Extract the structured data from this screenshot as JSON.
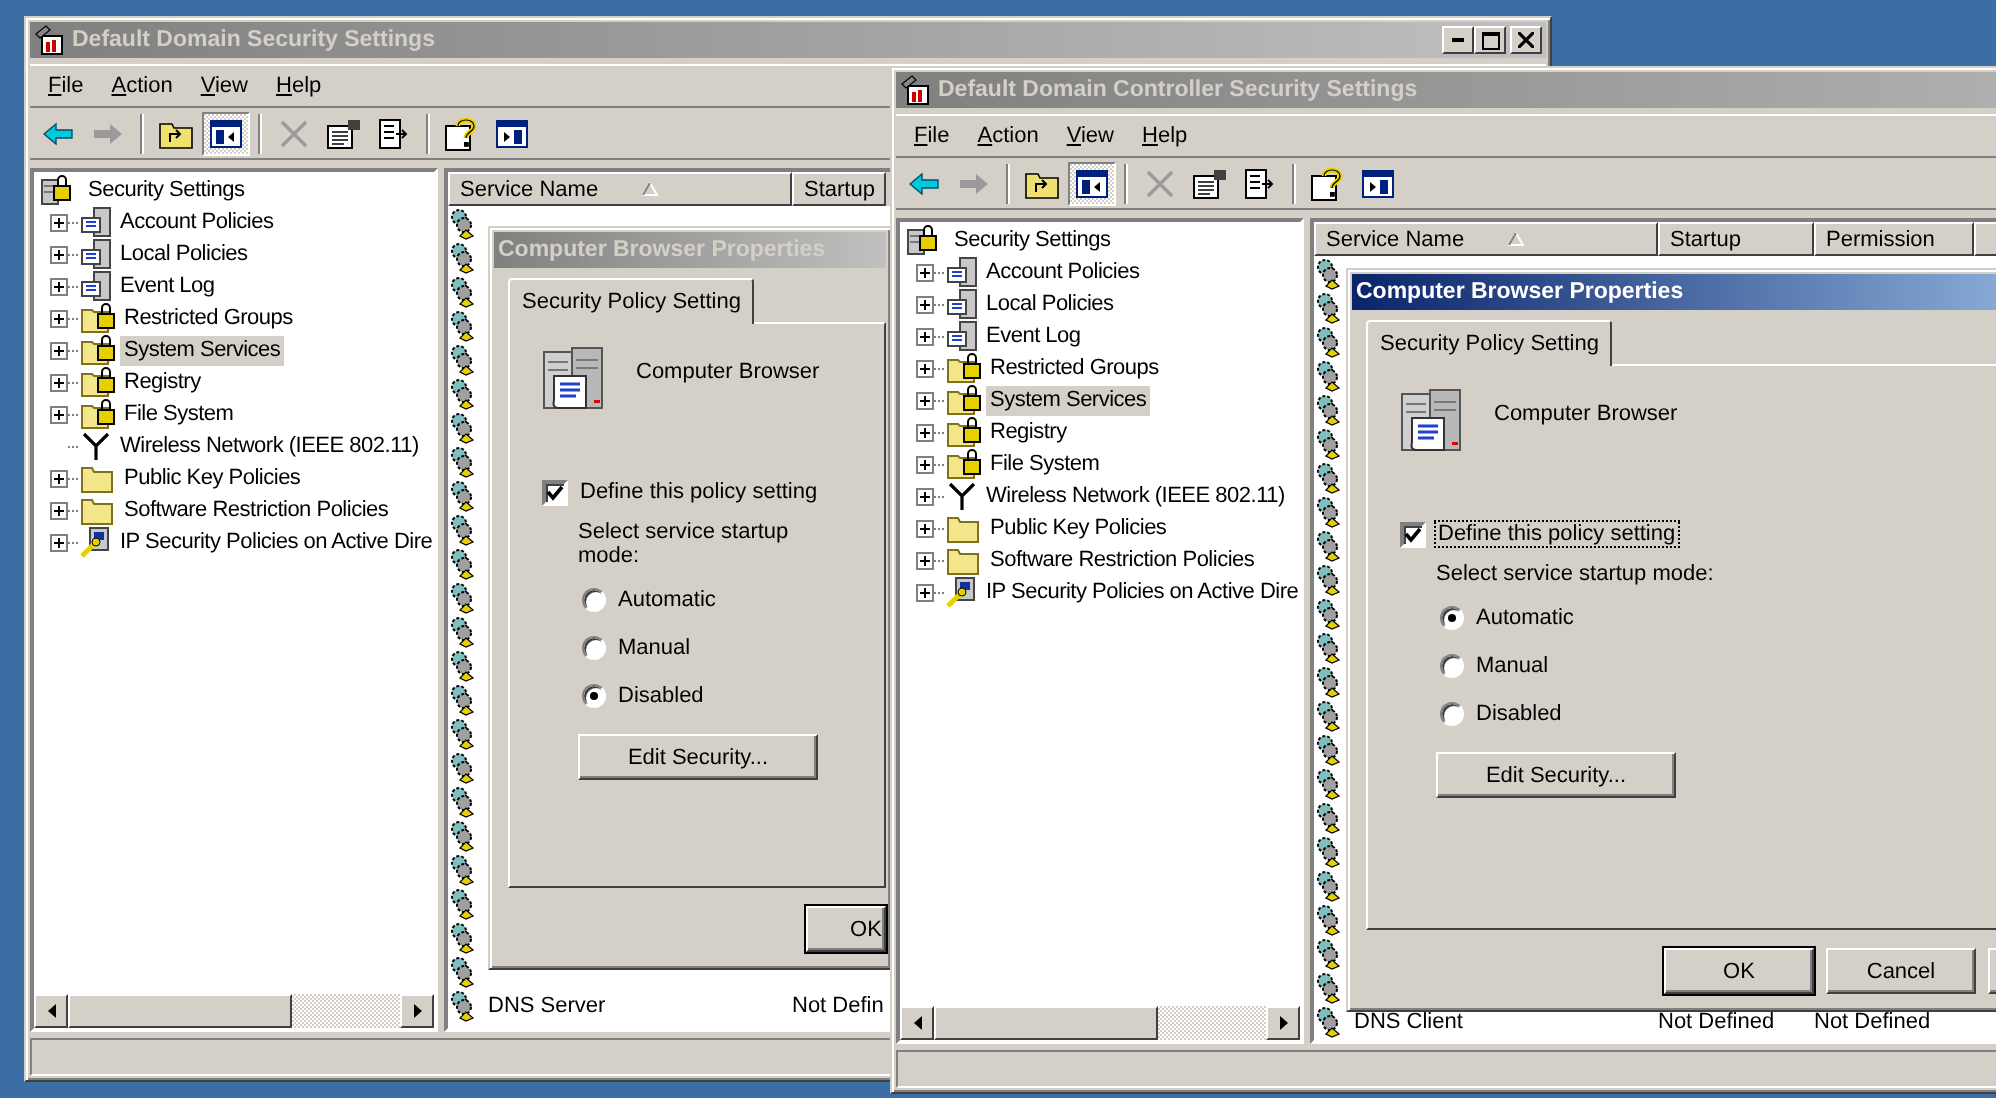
{
  "windows": [
    {
      "title": "Default Domain Security Settings",
      "active": false,
      "menu": [
        "File",
        "Action",
        "View",
        "Help"
      ],
      "tree": {
        "label": "Security Settings",
        "kind": "root",
        "children": [
          {
            "label": "Account Policies",
            "kind": "policy",
            "expandable": true,
            "selected": false
          },
          {
            "label": "Local Policies",
            "kind": "policy",
            "expandable": true,
            "selected": false
          },
          {
            "label": "Event Log",
            "kind": "policy",
            "expandable": true,
            "selected": false
          },
          {
            "label": "Restricted Groups",
            "kind": "locked-folder",
            "expandable": true,
            "selected": false
          },
          {
            "label": "System Services",
            "kind": "locked-folder",
            "expandable": true,
            "selected": true
          },
          {
            "label": "Registry",
            "kind": "locked-folder",
            "expandable": true,
            "selected": false
          },
          {
            "label": "File System",
            "kind": "locked-folder",
            "expandable": true,
            "selected": false
          },
          {
            "label": "Wireless Network (IEEE 802.11)",
            "kind": "antenna",
            "expandable": false,
            "selected": false
          },
          {
            "label": "Public Key Policies",
            "kind": "folder",
            "expandable": true,
            "selected": false
          },
          {
            "label": "Software Restriction Policies",
            "kind": "folder",
            "expandable": true,
            "selected": false
          },
          {
            "label": "IP Security Policies on Active Dire",
            "kind": "ipsec",
            "expandable": true,
            "selected": false
          }
        ]
      },
      "list": {
        "sorted_ascending": true,
        "columns": [
          {
            "label": "Service Name"
          },
          {
            "label": "Startup"
          }
        ],
        "rows": [
          {
            "cells": [
              "DNS Server",
              "Not Defin"
            ]
          }
        ]
      },
      "dialog": {
        "title": "Computer Browser Properties",
        "active": false,
        "tab": {
          "label": "Security Policy Setting",
          "selected": true
        },
        "service_name": "Computer Browser",
        "define": {
          "label": "Define this policy setting",
          "checked": true,
          "focused": false
        },
        "mode_label": "Select service startup mode:",
        "modes": [
          {
            "label": "Automatic",
            "selected": false
          },
          {
            "label": "Manual",
            "selected": false
          },
          {
            "label": "Disabled",
            "selected": true
          }
        ],
        "edit_button": "Edit Security...",
        "buttons": [
          "OK"
        ]
      }
    },
    {
      "title": "Default Domain Controller Security Settings",
      "active": false,
      "menu": [
        "File",
        "Action",
        "View",
        "Help"
      ],
      "tree": {
        "label": "Security Settings",
        "kind": "root",
        "children": [
          {
            "label": "Account Policies",
            "kind": "policy",
            "expandable": true,
            "selected": false
          },
          {
            "label": "Local Policies",
            "kind": "policy",
            "expandable": true,
            "selected": false
          },
          {
            "label": "Event Log",
            "kind": "policy",
            "expandable": true,
            "selected": false
          },
          {
            "label": "Restricted Groups",
            "kind": "locked-folder",
            "expandable": true,
            "selected": false
          },
          {
            "label": "System Services",
            "kind": "locked-folder",
            "expandable": true,
            "selected": true
          },
          {
            "label": "Registry",
            "kind": "locked-folder",
            "expandable": true,
            "selected": false
          },
          {
            "label": "File System",
            "kind": "locked-folder",
            "expandable": true,
            "selected": false
          },
          {
            "label": "Wireless Network (IEEE 802.11)",
            "kind": "antenna",
            "expandable": true,
            "selected": false
          },
          {
            "label": "Public Key Policies",
            "kind": "folder",
            "expandable": true,
            "selected": false
          },
          {
            "label": "Software Restriction Policies",
            "kind": "folder",
            "expandable": true,
            "selected": false
          },
          {
            "label": "IP Security Policies on Active Dire",
            "kind": "ipsec",
            "expandable": true,
            "selected": false
          }
        ]
      },
      "list": {
        "sorted_ascending": true,
        "columns": [
          {
            "label": "Service Name"
          },
          {
            "label": "Startup"
          },
          {
            "label": "Permission"
          }
        ],
        "rows": [
          {
            "cells": [
              "DNS Client",
              "Not Defined",
              "Not Defined"
            ]
          }
        ]
      },
      "dialog": {
        "title": "Computer Browser Properties",
        "active": true,
        "tab": {
          "label": "Security Policy Setting",
          "selected": true
        },
        "service_name": "Computer Browser",
        "define": {
          "label": "Define this policy setting",
          "checked": true,
          "focused": true
        },
        "mode_label": "Select service startup mode:",
        "modes": [
          {
            "label": "Automatic",
            "selected": true
          },
          {
            "label": "Manual",
            "selected": false
          },
          {
            "label": "Disabled",
            "selected": false
          }
        ],
        "edit_button": "Edit Security...",
        "buttons": [
          "OK",
          "Cancel"
        ]
      }
    }
  ]
}
